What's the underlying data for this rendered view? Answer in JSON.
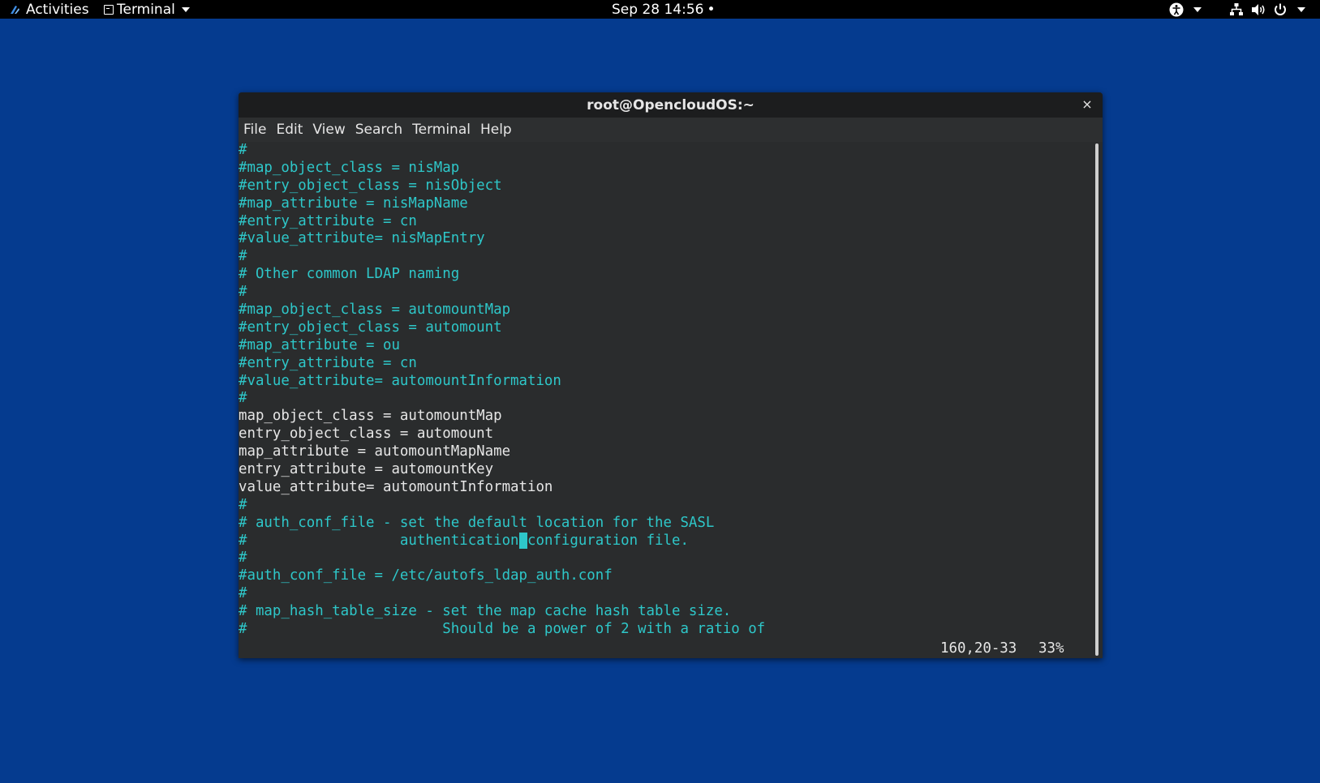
{
  "topbar": {
    "activities": "Activities",
    "app_menu": "Terminal",
    "clock": "Sep 28  14:56",
    "clock_dot": "•"
  },
  "window": {
    "title": "root@OpencloudOS:~",
    "close": "×",
    "menu": [
      "File",
      "Edit",
      "View",
      "Search",
      "Terminal",
      "Help"
    ]
  },
  "terminal": {
    "lines": [
      {
        "type": "comment",
        "text": "#"
      },
      {
        "type": "comment",
        "text": "#map_object_class = nisMap"
      },
      {
        "type": "comment",
        "text": "#entry_object_class = nisObject"
      },
      {
        "type": "comment",
        "text": "#map_attribute = nisMapName"
      },
      {
        "type": "comment",
        "text": "#entry_attribute = cn"
      },
      {
        "type": "comment",
        "text": "#value_attribute= nisMapEntry"
      },
      {
        "type": "comment",
        "text": "#"
      },
      {
        "type": "comment",
        "text": "# Other common LDAP naming"
      },
      {
        "type": "comment",
        "text": "#"
      },
      {
        "type": "comment",
        "text": "#map_object_class = automountMap"
      },
      {
        "type": "comment",
        "text": "#entry_object_class = automount"
      },
      {
        "type": "comment",
        "text": "#map_attribute = ou"
      },
      {
        "type": "comment",
        "text": "#entry_attribute = cn"
      },
      {
        "type": "comment",
        "text": "#value_attribute= automountInformation"
      },
      {
        "type": "comment",
        "text": "#"
      },
      {
        "type": "plain",
        "text": "map_object_class = automountMap"
      },
      {
        "type": "plain",
        "text": "entry_object_class = automount"
      },
      {
        "type": "plain",
        "text": "map_attribute = automountMapName"
      },
      {
        "type": "plain",
        "text": "entry_attribute = automountKey"
      },
      {
        "type": "plain",
        "text": "value_attribute= automountInformation"
      },
      {
        "type": "comment",
        "text": "#"
      },
      {
        "type": "comment",
        "text": "# auth_conf_file - set the default location for the SASL"
      },
      {
        "type": "comment",
        "text": "#                  authentication configuration file.",
        "cursor_col": 33
      },
      {
        "type": "comment",
        "text": "#"
      },
      {
        "type": "comment",
        "text": "#auth_conf_file = /etc/autofs_ldap_auth.conf"
      },
      {
        "type": "comment",
        "text": "#"
      },
      {
        "type": "comment",
        "text": "# map_hash_table_size - set the map cache hash table size."
      },
      {
        "type": "comment",
        "text": "#                       Should be a power of 2 with a ratio of"
      }
    ],
    "status_position": "160,20-33",
    "status_percent": "33%"
  },
  "colors": {
    "desktop": "#053b8f",
    "comment": "#2ec7c9",
    "text": "#e6e6e6"
  },
  "icons": [
    "accessibility-icon",
    "network-icon",
    "volume-icon",
    "power-icon"
  ]
}
